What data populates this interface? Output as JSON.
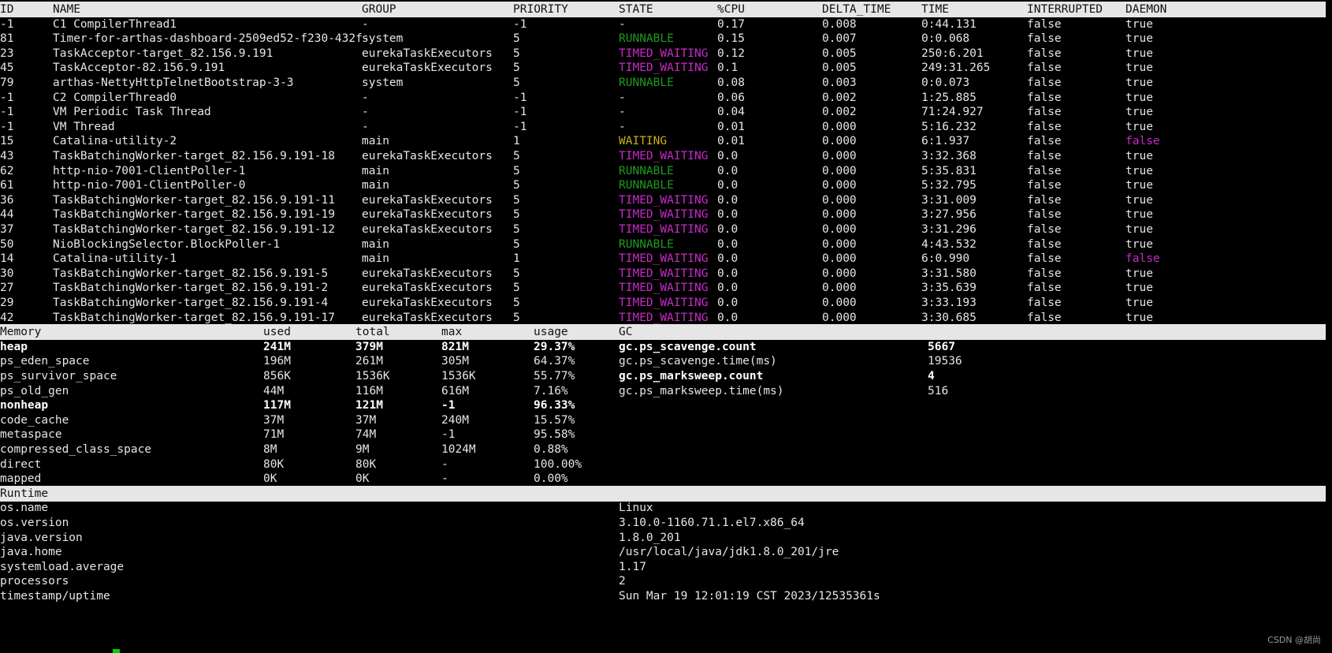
{
  "threads": {
    "headers": [
      "ID",
      "NAME",
      "GROUP",
      "PRIORITY",
      "STATE",
      "%CPU",
      "DELTA_TIME",
      "TIME",
      "INTERRUPTED",
      "DAEMON"
    ],
    "rows": [
      {
        "id": "-1",
        "name": "C1 CompilerThread1",
        "group": "-",
        "priority": "-1",
        "state": "-",
        "cpu": "0.17",
        "delta": "0.008",
        "time": "0:44.131",
        "interrupted": "false",
        "daemon": "true"
      },
      {
        "id": "81",
        "name": "Timer-for-arthas-dashboard-2509ed52-f230-432f-",
        "group": "system",
        "priority": "5",
        "state": "RUNNABLE",
        "cpu": "0.15",
        "delta": "0.007",
        "time": "0:0.068",
        "interrupted": "false",
        "daemon": "true"
      },
      {
        "id": "23",
        "name": "TaskAcceptor-target_82.156.9.191",
        "group": "eurekaTaskExecutors",
        "priority": "5",
        "state": "TIMED_WAITING",
        "cpu": "0.12",
        "delta": "0.005",
        "time": "250:6.201",
        "interrupted": "false",
        "daemon": "true"
      },
      {
        "id": "45",
        "name": "TaskAcceptor-82.156.9.191",
        "group": "eurekaTaskExecutors",
        "priority": "5",
        "state": "TIMED_WAITING",
        "cpu": "0.1",
        "delta": "0.005",
        "time": "249:31.265",
        "interrupted": "false",
        "daemon": "true"
      },
      {
        "id": "79",
        "name": "arthas-NettyHttpTelnetBootstrap-3-3",
        "group": "system",
        "priority": "5",
        "state": "RUNNABLE",
        "cpu": "0.08",
        "delta": "0.003",
        "time": "0:0.073",
        "interrupted": "false",
        "daemon": "true"
      },
      {
        "id": "-1",
        "name": "C2 CompilerThread0",
        "group": "-",
        "priority": "-1",
        "state": "-",
        "cpu": "0.06",
        "delta": "0.002",
        "time": "1:25.885",
        "interrupted": "false",
        "daemon": "true"
      },
      {
        "id": "-1",
        "name": "VM Periodic Task Thread",
        "group": "-",
        "priority": "-1",
        "state": "-",
        "cpu": "0.04",
        "delta": "0.002",
        "time": "71:24.927",
        "interrupted": "false",
        "daemon": "true"
      },
      {
        "id": "-1",
        "name": "VM Thread",
        "group": "-",
        "priority": "-1",
        "state": "-",
        "cpu": "0.01",
        "delta": "0.000",
        "time": "5:16.232",
        "interrupted": "false",
        "daemon": "true"
      },
      {
        "id": "15",
        "name": "Catalina-utility-2",
        "group": "main",
        "priority": "1",
        "state": "WAITING",
        "cpu": "0.01",
        "delta": "0.000",
        "time": "6:1.937",
        "interrupted": "false",
        "daemon": "false"
      },
      {
        "id": "43",
        "name": "TaskBatchingWorker-target_82.156.9.191-18",
        "group": "eurekaTaskExecutors",
        "priority": "5",
        "state": "TIMED_WAITING",
        "cpu": "0.0",
        "delta": "0.000",
        "time": "3:32.368",
        "interrupted": "false",
        "daemon": "true"
      },
      {
        "id": "62",
        "name": "http-nio-7001-ClientPoller-1",
        "group": "main",
        "priority": "5",
        "state": "RUNNABLE",
        "cpu": "0.0",
        "delta": "0.000",
        "time": "5:35.831",
        "interrupted": "false",
        "daemon": "true"
      },
      {
        "id": "61",
        "name": "http-nio-7001-ClientPoller-0",
        "group": "main",
        "priority": "5",
        "state": "RUNNABLE",
        "cpu": "0.0",
        "delta": "0.000",
        "time": "5:32.795",
        "interrupted": "false",
        "daemon": "true"
      },
      {
        "id": "36",
        "name": "TaskBatchingWorker-target_82.156.9.191-11",
        "group": "eurekaTaskExecutors",
        "priority": "5",
        "state": "TIMED_WAITING",
        "cpu": "0.0",
        "delta": "0.000",
        "time": "3:31.009",
        "interrupted": "false",
        "daemon": "true"
      },
      {
        "id": "44",
        "name": "TaskBatchingWorker-target_82.156.9.191-19",
        "group": "eurekaTaskExecutors",
        "priority": "5",
        "state": "TIMED_WAITING",
        "cpu": "0.0",
        "delta": "0.000",
        "time": "3:27.956",
        "interrupted": "false",
        "daemon": "true"
      },
      {
        "id": "37",
        "name": "TaskBatchingWorker-target_82.156.9.191-12",
        "group": "eurekaTaskExecutors",
        "priority": "5",
        "state": "TIMED_WAITING",
        "cpu": "0.0",
        "delta": "0.000",
        "time": "3:31.296",
        "interrupted": "false",
        "daemon": "true"
      },
      {
        "id": "50",
        "name": "NioBlockingSelector.BlockPoller-1",
        "group": "main",
        "priority": "5",
        "state": "RUNNABLE",
        "cpu": "0.0",
        "delta": "0.000",
        "time": "4:43.532",
        "interrupted": "false",
        "daemon": "true"
      },
      {
        "id": "14",
        "name": "Catalina-utility-1",
        "group": "main",
        "priority": "1",
        "state": "TIMED_WAITING",
        "cpu": "0.0",
        "delta": "0.000",
        "time": "6:0.990",
        "interrupted": "false",
        "daemon": "false"
      },
      {
        "id": "30",
        "name": "TaskBatchingWorker-target_82.156.9.191-5",
        "group": "eurekaTaskExecutors",
        "priority": "5",
        "state": "TIMED_WAITING",
        "cpu": "0.0",
        "delta": "0.000",
        "time": "3:31.580",
        "interrupted": "false",
        "daemon": "true"
      },
      {
        "id": "27",
        "name": "TaskBatchingWorker-target_82.156.9.191-2",
        "group": "eurekaTaskExecutors",
        "priority": "5",
        "state": "TIMED_WAITING",
        "cpu": "0.0",
        "delta": "0.000",
        "time": "3:35.639",
        "interrupted": "false",
        "daemon": "true"
      },
      {
        "id": "29",
        "name": "TaskBatchingWorker-target_82.156.9.191-4",
        "group": "eurekaTaskExecutors",
        "priority": "5",
        "state": "TIMED_WAITING",
        "cpu": "0.0",
        "delta": "0.000",
        "time": "3:33.193",
        "interrupted": "false",
        "daemon": "true"
      },
      {
        "id": "42",
        "name": "TaskBatchingWorker-target_82.156.9.191-17",
        "group": "eurekaTaskExecutors",
        "priority": "5",
        "state": "TIMED_WAITING",
        "cpu": "0.0",
        "delta": "0.000",
        "time": "3:30.685",
        "interrupted": "false",
        "daemon": "true"
      }
    ]
  },
  "memory": {
    "headers": [
      "Memory",
      "used",
      "total",
      "max",
      "usage"
    ],
    "gc_header": "GC",
    "rows": [
      {
        "name": "heap",
        "used": "241M",
        "total": "379M",
        "max": "821M",
        "usage": "29.37%",
        "bold": true
      },
      {
        "name": "ps_eden_space",
        "used": "196M",
        "total": "261M",
        "max": "305M",
        "usage": "64.37%",
        "bold": false
      },
      {
        "name": "ps_survivor_space",
        "used": "856K",
        "total": "1536K",
        "max": "1536K",
        "usage": "55.77%",
        "bold": false
      },
      {
        "name": "ps_old_gen",
        "used": "44M",
        "total": "116M",
        "max": "616M",
        "usage": "7.16%",
        "bold": false
      },
      {
        "name": "nonheap",
        "used": "117M",
        "total": "121M",
        "max": "-1",
        "usage": "96.33%",
        "bold": true
      },
      {
        "name": "code_cache",
        "used": "37M",
        "total": "37M",
        "max": "240M",
        "usage": "15.57%",
        "bold": false
      },
      {
        "name": "metaspace",
        "used": "71M",
        "total": "74M",
        "max": "-1",
        "usage": "95.58%",
        "bold": false
      },
      {
        "name": "compressed_class_space",
        "used": "8M",
        "total": "9M",
        "max": "1024M",
        "usage": "0.88%",
        "bold": false
      },
      {
        "name": "direct",
        "used": "80K",
        "total": "80K",
        "max": "-",
        "usage": "100.00%",
        "bold": false
      },
      {
        "name": "mapped",
        "used": "0K",
        "total": "0K",
        "max": "-",
        "usage": "0.00%",
        "bold": false
      }
    ]
  },
  "gc": [
    {
      "name": "gc.ps_scavenge.count",
      "value": "5667",
      "bold": true
    },
    {
      "name": "gc.ps_scavenge.time(ms)",
      "value": "19536",
      "bold": false
    },
    {
      "name": "gc.ps_marksweep.count",
      "value": "4",
      "bold": true
    },
    {
      "name": "gc.ps_marksweep.time(ms)",
      "value": "516",
      "bold": false
    }
  ],
  "runtime": {
    "header": "Runtime",
    "rows": [
      {
        "key": "os.name",
        "value": "Linux"
      },
      {
        "key": "os.version",
        "value": "3.10.0-1160.71.1.el7.x86_64"
      },
      {
        "key": "java.version",
        "value": "1.8.0_201"
      },
      {
        "key": "java.home",
        "value": "/usr/local/java/jdk1.8.0_201/jre"
      },
      {
        "key": "systemload.average",
        "value": "1.17"
      },
      {
        "key": "processors",
        "value": "2"
      },
      {
        "key": "timestamp/uptime",
        "value": "Sun Mar 19 12:01:19 CST 2023/12535361s"
      }
    ]
  },
  "watermark": "CSDN @胡尚",
  "colors": {
    "runnable": "#1d9a1d",
    "timed_waiting": "#c92ac9",
    "waiting": "#c9b017",
    "daemon_false": "#c92ac9",
    "cursor": "#00d200"
  }
}
